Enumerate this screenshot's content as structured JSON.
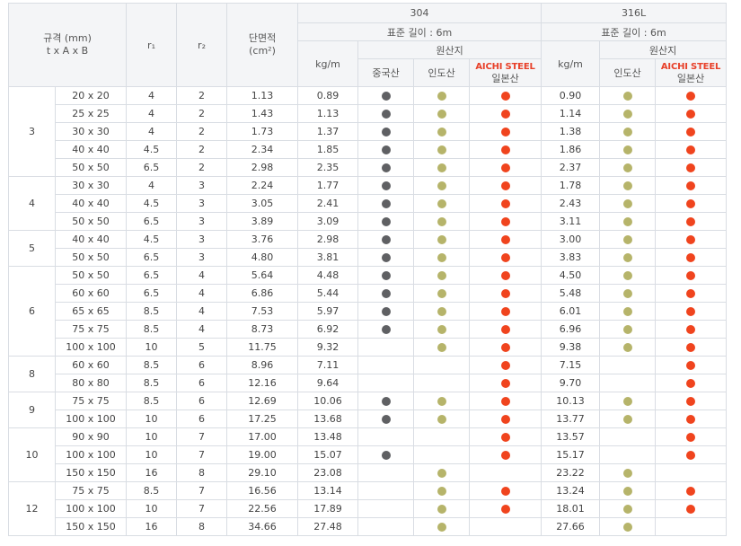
{
  "header": {
    "spec_line1": "규격 (mm)",
    "spec_line2": "t x A x B",
    "r1": "r₁",
    "r2": "r₂",
    "area_line1": "단면적",
    "area_line2": "(cm²)",
    "grade_304": "304",
    "grade_316l": "316L",
    "std_length": "표준 길이 : 6m",
    "origin": "원산지",
    "kgm": "kg/m",
    "china": "중국산",
    "india": "인도산",
    "aichi": "AICHI STEEL",
    "japan": "일본산"
  },
  "colors": {
    "china": "#5f6063",
    "india": "#b6b46a",
    "japan": "#f0441e"
  },
  "groups": [
    {
      "t": "3",
      "rows": [
        {
          "size": "20 x 20",
          "r1": "4",
          "r2": "2",
          "area": "1.13",
          "kgm304": "0.89",
          "cn": true,
          "in304": true,
          "jp304": true,
          "kgm316": "0.90",
          "in316": true,
          "jp316": true
        },
        {
          "size": "25 x 25",
          "r1": "4",
          "r2": "2",
          "area": "1.43",
          "kgm304": "1.13",
          "cn": true,
          "in304": true,
          "jp304": true,
          "kgm316": "1.14",
          "in316": true,
          "jp316": true
        },
        {
          "size": "30 x 30",
          "r1": "4",
          "r2": "2",
          "area": "1.73",
          "kgm304": "1.37",
          "cn": true,
          "in304": true,
          "jp304": true,
          "kgm316": "1.38",
          "in316": true,
          "jp316": true
        },
        {
          "size": "40 x 40",
          "r1": "4.5",
          "r2": "2",
          "area": "2.34",
          "kgm304": "1.85",
          "cn": true,
          "in304": true,
          "jp304": true,
          "kgm316": "1.86",
          "in316": true,
          "jp316": true
        },
        {
          "size": "50 x 50",
          "r1": "6.5",
          "r2": "2",
          "area": "2.98",
          "kgm304": "2.35",
          "cn": true,
          "in304": true,
          "jp304": true,
          "kgm316": "2.37",
          "in316": true,
          "jp316": true
        }
      ]
    },
    {
      "t": "4",
      "rows": [
        {
          "size": "30 x 30",
          "r1": "4",
          "r2": "3",
          "area": "2.24",
          "kgm304": "1.77",
          "cn": true,
          "in304": true,
          "jp304": true,
          "kgm316": "1.78",
          "in316": true,
          "jp316": true
        },
        {
          "size": "40 x 40",
          "r1": "4.5",
          "r2": "3",
          "area": "3.05",
          "kgm304": "2.41",
          "cn": true,
          "in304": true,
          "jp304": true,
          "kgm316": "2.43",
          "in316": true,
          "jp316": true
        },
        {
          "size": "50 x 50",
          "r1": "6.5",
          "r2": "3",
          "area": "3.89",
          "kgm304": "3.09",
          "cn": true,
          "in304": true,
          "jp304": true,
          "kgm316": "3.11",
          "in316": true,
          "jp316": true
        }
      ]
    },
    {
      "t": "5",
      "rows": [
        {
          "size": "40 x 40",
          "r1": "4.5",
          "r2": "3",
          "area": "3.76",
          "kgm304": "2.98",
          "cn": true,
          "in304": true,
          "jp304": true,
          "kgm316": "3.00",
          "in316": true,
          "jp316": true
        },
        {
          "size": "50 x 50",
          "r1": "6.5",
          "r2": "3",
          "area": "4.80",
          "kgm304": "3.81",
          "cn": true,
          "in304": true,
          "jp304": true,
          "kgm316": "3.83",
          "in316": true,
          "jp316": true
        }
      ]
    },
    {
      "t": "6",
      "rows": [
        {
          "size": "50 x 50",
          "r1": "6.5",
          "r2": "4",
          "area": "5.64",
          "kgm304": "4.48",
          "cn": true,
          "in304": true,
          "jp304": true,
          "kgm316": "4.50",
          "in316": true,
          "jp316": true
        },
        {
          "size": "60 x 60",
          "r1": "6.5",
          "r2": "4",
          "area": "6.86",
          "kgm304": "5.44",
          "cn": true,
          "in304": true,
          "jp304": true,
          "kgm316": "5.48",
          "in316": true,
          "jp316": true
        },
        {
          "size": "65 x 65",
          "r1": "8.5",
          "r2": "4",
          "area": "7.53",
          "kgm304": "5.97",
          "cn": true,
          "in304": true,
          "jp304": true,
          "kgm316": "6.01",
          "in316": true,
          "jp316": true
        },
        {
          "size": "75 x 75",
          "r1": "8.5",
          "r2": "4",
          "area": "8.73",
          "kgm304": "6.92",
          "cn": true,
          "in304": true,
          "jp304": true,
          "kgm316": "6.96",
          "in316": true,
          "jp316": true
        },
        {
          "size": "100 x 100",
          "r1": "10",
          "r2": "5",
          "area": "11.75",
          "kgm304": "9.32",
          "cn": false,
          "in304": true,
          "jp304": true,
          "kgm316": "9.38",
          "in316": true,
          "jp316": true
        }
      ]
    },
    {
      "t": "8",
      "rows": [
        {
          "size": "60 x 60",
          "r1": "8.5",
          "r2": "6",
          "area": "8.96",
          "kgm304": "7.11",
          "cn": false,
          "in304": false,
          "jp304": true,
          "kgm316": "7.15",
          "in316": false,
          "jp316": true
        },
        {
          "size": "80 x 80",
          "r1": "8.5",
          "r2": "6",
          "area": "12.16",
          "kgm304": "9.64",
          "cn": false,
          "in304": false,
          "jp304": true,
          "kgm316": "9.70",
          "in316": false,
          "jp316": true
        }
      ]
    },
    {
      "t": "9",
      "rows": [
        {
          "size": "75 x 75",
          "r1": "8.5",
          "r2": "6",
          "area": "12.69",
          "kgm304": "10.06",
          "cn": true,
          "in304": true,
          "jp304": true,
          "kgm316": "10.13",
          "in316": true,
          "jp316": true
        },
        {
          "size": "100 x 100",
          "r1": "10",
          "r2": "6",
          "area": "17.25",
          "kgm304": "13.68",
          "cn": true,
          "in304": true,
          "jp304": true,
          "kgm316": "13.77",
          "in316": true,
          "jp316": true
        }
      ]
    },
    {
      "t": "10",
      "rows": [
        {
          "size": "90 x 90",
          "r1": "10",
          "r2": "7",
          "area": "17.00",
          "kgm304": "13.48",
          "cn": false,
          "in304": false,
          "jp304": true,
          "kgm316": "13.57",
          "in316": false,
          "jp316": true
        },
        {
          "size": "100 x 100",
          "r1": "10",
          "r2": "7",
          "area": "19.00",
          "kgm304": "15.07",
          "cn": true,
          "in304": false,
          "jp304": true,
          "kgm316": "15.17",
          "in316": false,
          "jp316": true
        },
        {
          "size": "150 x 150",
          "r1": "16",
          "r2": "8",
          "area": "29.10",
          "kgm304": "23.08",
          "cn": false,
          "in304": true,
          "jp304": false,
          "kgm316": "23.22",
          "in316": true,
          "jp316": false
        }
      ]
    },
    {
      "t": "12",
      "rows": [
        {
          "size": "75 x 75",
          "r1": "8.5",
          "r2": "7",
          "area": "16.56",
          "kgm304": "13.14",
          "cn": false,
          "in304": true,
          "jp304": true,
          "kgm316": "13.24",
          "in316": true,
          "jp316": true
        },
        {
          "size": "100 x 100",
          "r1": "10",
          "r2": "7",
          "area": "22.56",
          "kgm304": "17.89",
          "cn": false,
          "in304": true,
          "jp304": true,
          "kgm316": "18.01",
          "in316": true,
          "jp316": true
        },
        {
          "size": "150 x 150",
          "r1": "16",
          "r2": "8",
          "area": "34.66",
          "kgm304": "27.48",
          "cn": false,
          "in304": true,
          "jp304": false,
          "kgm316": "27.66",
          "in316": true,
          "jp316": false
        }
      ]
    }
  ]
}
